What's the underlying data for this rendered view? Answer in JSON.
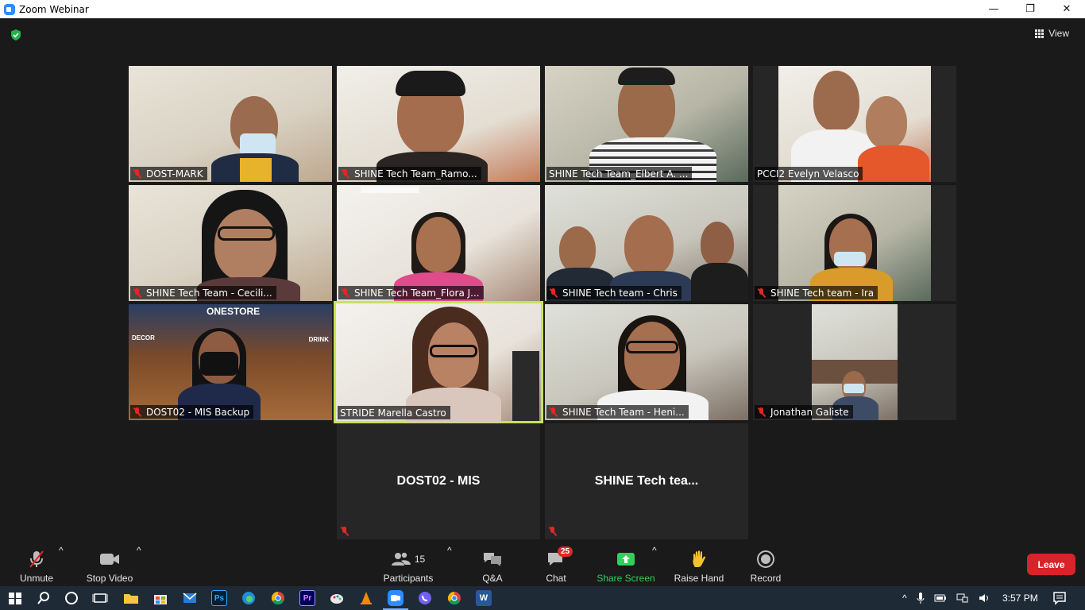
{
  "window": {
    "title": "Zoom Webinar",
    "controls": {
      "minimize": "—",
      "restore": "❐",
      "close": "✕"
    }
  },
  "header": {
    "view_label": "View",
    "security_icon": "shield-check-icon"
  },
  "gallery": {
    "tiles": [
      {
        "name": "DOST-MARK",
        "muted": true,
        "video": true
      },
      {
        "name": "SHINE Tech Team_Ramo...",
        "muted": true,
        "video": true
      },
      {
        "name": "SHINE Tech Team_Elbert A. ...",
        "muted": false,
        "video": true
      },
      {
        "name": "PCCI2 Evelyn Velasco",
        "muted": false,
        "video": true
      },
      {
        "name": "SHINE Tech Team - Cecili...",
        "muted": true,
        "video": true
      },
      {
        "name": "SHINE Tech Team_Flora J...",
        "muted": true,
        "video": true
      },
      {
        "name": "SHINE Tech team - Chris",
        "muted": true,
        "video": true
      },
      {
        "name": "SHINE Tech team - Ira",
        "muted": true,
        "video": true
      },
      {
        "name": "DOST02 - MIS Backup",
        "muted": true,
        "video": true
      },
      {
        "name": "STRIDE Marella Castro",
        "muted": false,
        "video": true,
        "active_speaker": true
      },
      {
        "name": "SHINE Tech Team - Heni...",
        "muted": true,
        "video": true
      },
      {
        "name": "Jonathan Galiste",
        "muted": true,
        "video": true
      },
      {
        "name": "DOST02 - MIS",
        "muted": true,
        "video": false
      },
      {
        "name": "SHINE Tech tea...",
        "muted": true,
        "video": false
      }
    ],
    "store_sign": "ONESTORE",
    "store_decor": "DECOR",
    "store_drink": "DRINK"
  },
  "toolbar": {
    "unmute": "Unmute",
    "stop_video": "Stop Video",
    "participants": "Participants",
    "participants_count": "15",
    "qa": "Q&A",
    "chat": "Chat",
    "chat_badge": "25",
    "share_screen": "Share Screen",
    "raise_hand": "Raise Hand",
    "record": "Record",
    "leave": "Leave",
    "accent_green": "#2fd15c",
    "leave_red": "#d7242a"
  },
  "taskbar": {
    "clock": "3:57 PM",
    "apps": [
      "windows-start-icon",
      "search-icon",
      "cortana-icon",
      "task-view-icon",
      "file-explorer-icon",
      "store-icon",
      "mail-icon",
      "photoshop-icon",
      "edge-icon",
      "chrome-icon",
      "premiere-icon",
      "paint-icon",
      "vlc-icon",
      "zoom-icon",
      "viber-icon",
      "chrome-icon",
      "word-icon"
    ],
    "photoshop_label": "Ps",
    "premiere_label": "Pr",
    "word_label": "W"
  }
}
